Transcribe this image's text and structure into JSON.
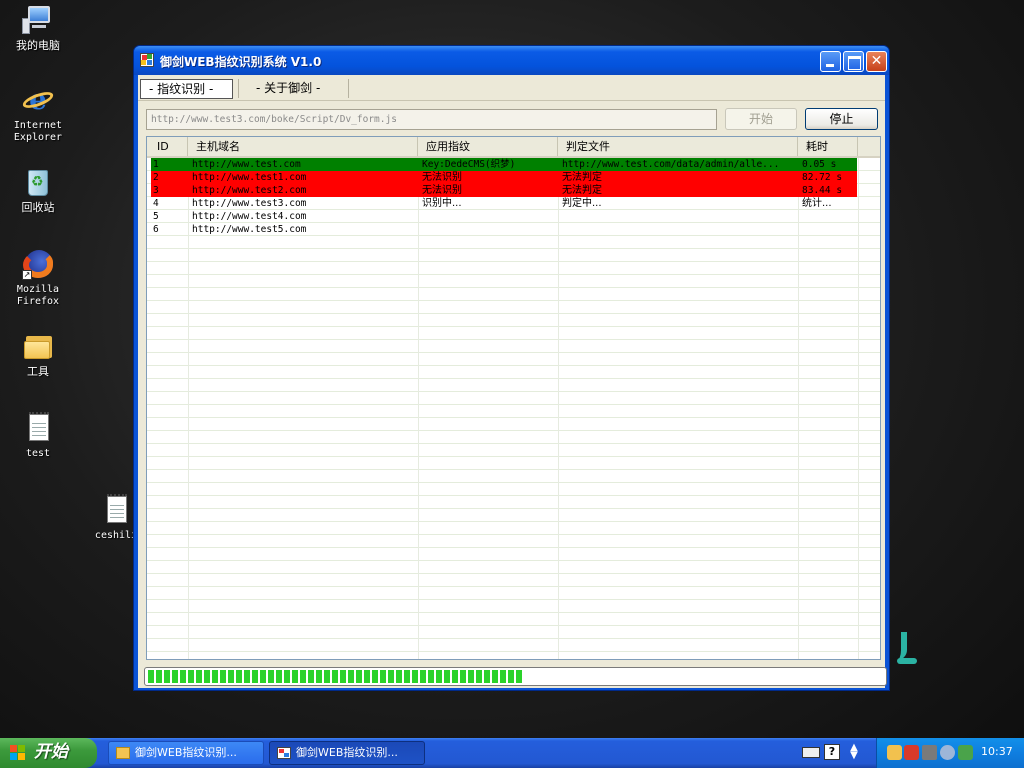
{
  "desktop": {
    "icons": [
      {
        "label": "我的电脑"
      },
      {
        "label_line1": "Internet",
        "label_line2": "Explorer"
      },
      {
        "label": "回收站"
      },
      {
        "label_line1": "Mozilla",
        "label_line2": "Firefox"
      },
      {
        "label": "工具"
      },
      {
        "label": "test"
      },
      {
        "label": "ceshili"
      }
    ]
  },
  "window": {
    "title": "御剑WEB指纹识别系统 V1.0",
    "tabs": [
      {
        "label": "- 指纹识别 -"
      },
      {
        "label": "- 关于御剑 -"
      }
    ],
    "url_input": {
      "value": "http://www.test3.com/boke/Script/Dv_form.js"
    },
    "buttons": {
      "start": "开始",
      "stop": "停止"
    },
    "table": {
      "headers": [
        "ID",
        "主机域名",
        "应用指纹",
        "判定文件",
        "耗时"
      ],
      "rows": [
        {
          "id": "1",
          "host": "http://www.test.com",
          "fingerprint": "Key:DedeCMS(织梦)",
          "file": "http://www.test.com/data/admin/alle...",
          "time": "0.05 s",
          "status": "success"
        },
        {
          "id": "2",
          "host": "http://www.test1.com",
          "fingerprint": "无法识别",
          "file": "无法判定",
          "time": "82.72 s",
          "status": "fail"
        },
        {
          "id": "3",
          "host": "http://www.test2.com",
          "fingerprint": "无法识别",
          "file": "无法判定",
          "time": "83.44 s",
          "status": "fail"
        },
        {
          "id": "4",
          "host": "http://www.test3.com",
          "fingerprint": "识别中...",
          "file": "判定中...",
          "time": "统计...",
          "status": "pending"
        },
        {
          "id": "5",
          "host": "http://www.test4.com",
          "fingerprint": "",
          "file": "",
          "time": "",
          "status": "idle"
        },
        {
          "id": "6",
          "host": "http://www.test5.com",
          "fingerprint": "",
          "file": "",
          "time": "",
          "status": "idle"
        }
      ]
    },
    "progress_fraction": 0.51
  },
  "taskbar": {
    "start_label": "开始",
    "tasks": [
      {
        "label": "御剑WEB指纹识别..."
      },
      {
        "label": "御剑WEB指纹识别..."
      }
    ],
    "clock": "10:37"
  },
  "colors": {
    "row_success": "#008000",
    "row_fail": "#ff0000",
    "titlebar": "#0453dc",
    "progress": "#2ad22a"
  }
}
